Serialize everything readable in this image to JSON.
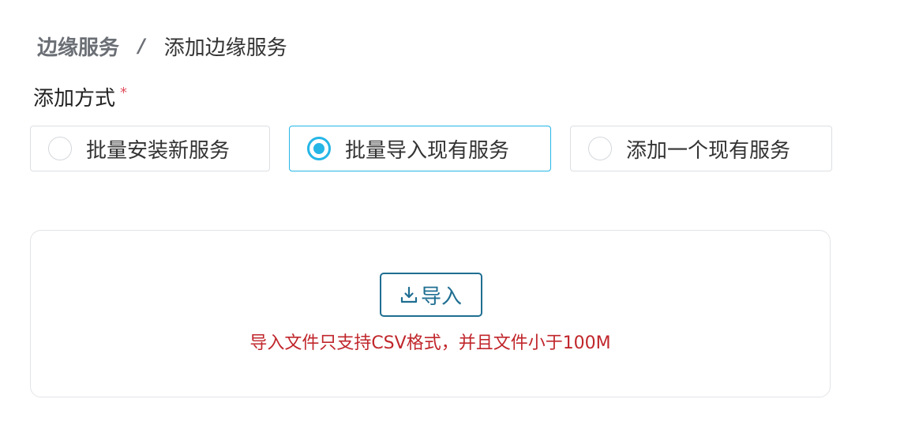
{
  "breadcrumb": {
    "parent": "边缘服务",
    "separator": "/",
    "current": "添加边缘服务"
  },
  "form": {
    "label": "添加方式",
    "required_mark": "*",
    "options": [
      {
        "label": "批量安装新服务",
        "selected": false
      },
      {
        "label": "批量导入现有服务",
        "selected": true
      },
      {
        "label": "添加一个现有服务",
        "selected": false
      }
    ]
  },
  "upload": {
    "button_label": "导入",
    "button_icon": "download-icon",
    "hint": "导入文件只支持CSV格式，并且文件小于100M"
  },
  "colors": {
    "accent": "#25b6e6",
    "button": "#1f6e92",
    "hint": "#c0262b",
    "required": "#e04f5f"
  }
}
